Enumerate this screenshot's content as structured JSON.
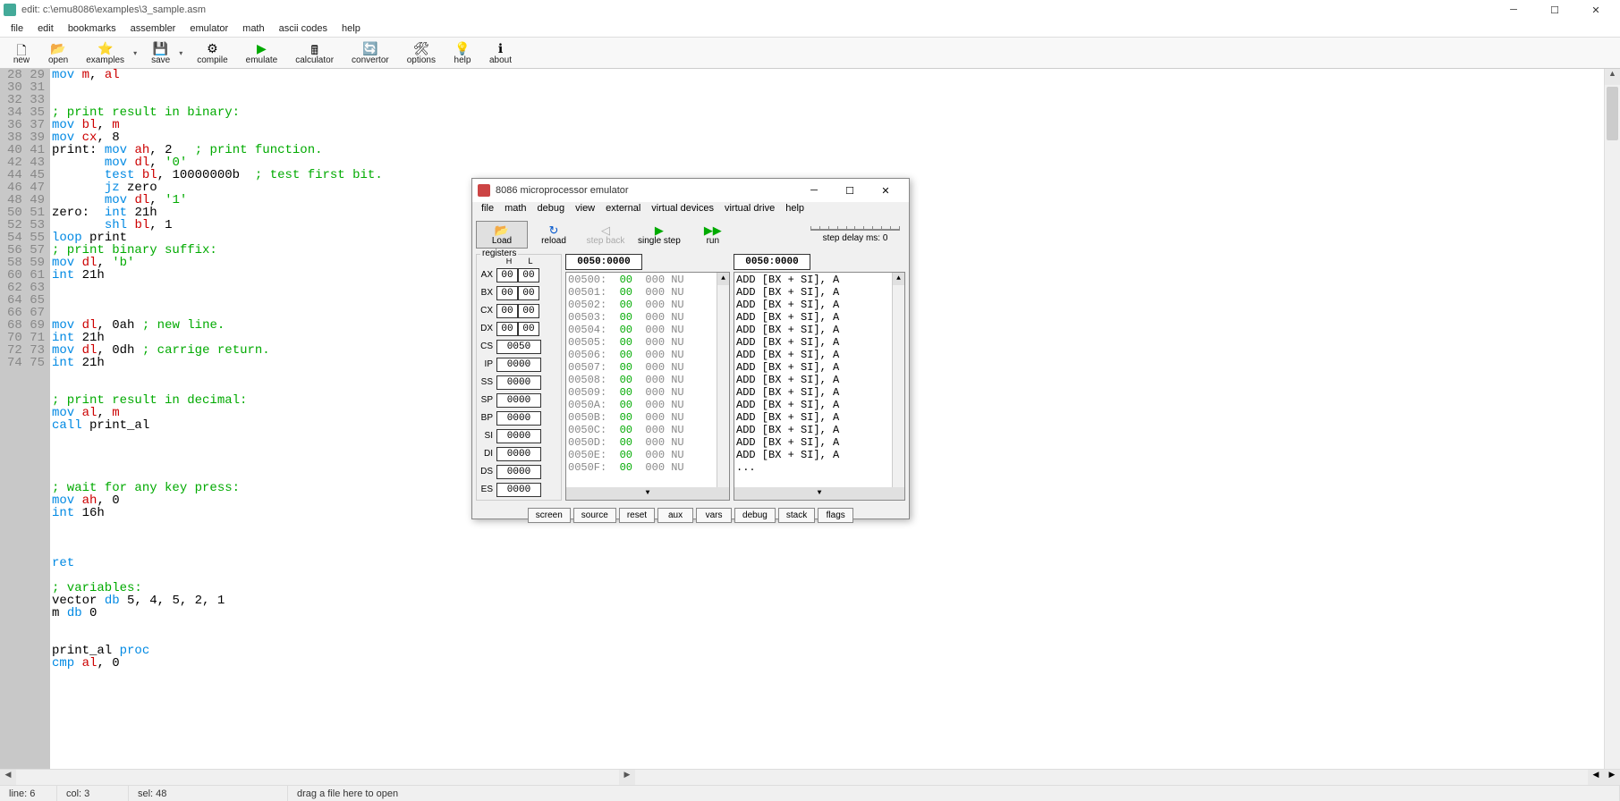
{
  "titlebar": {
    "title": "edit: c:\\emu8086\\examples\\3_sample.asm"
  },
  "menubar": [
    "file",
    "edit",
    "bookmarks",
    "assembler",
    "emulator",
    "math",
    "ascii codes",
    "help"
  ],
  "toolbar": [
    {
      "icon": "🗋",
      "label": "new"
    },
    {
      "icon": "📂",
      "label": "open"
    },
    {
      "icon": "⭐",
      "label": "examples",
      "dropdown": true
    },
    {
      "icon": "💾",
      "label": "save",
      "dropdown": true
    },
    {
      "icon": "⚙",
      "label": "compile"
    },
    {
      "icon": "▶",
      "label": "emulate",
      "color": "#0a0"
    },
    {
      "icon": "🖩",
      "label": "calculator"
    },
    {
      "icon": "🔄",
      "label": "convertor"
    },
    {
      "icon": "🛠",
      "label": "options"
    },
    {
      "icon": "💡",
      "label": "help"
    },
    {
      "icon": "ℹ",
      "label": "about"
    }
  ],
  "code_start_line": 28,
  "code_lines": [
    [
      [
        "kw",
        "mov"
      ],
      [
        " "
      ],
      [
        "reg",
        "m"
      ],
      [
        ", "
      ],
      [
        "reg",
        "al"
      ]
    ],
    [],
    [],
    [
      [
        "cmt",
        "; print result in binary:"
      ]
    ],
    [
      [
        "kw",
        "mov"
      ],
      [
        " "
      ],
      [
        "reg",
        "bl"
      ],
      [
        ", "
      ],
      [
        "reg",
        "m"
      ]
    ],
    [
      [
        "kw",
        "mov"
      ],
      [
        " "
      ],
      [
        "reg",
        "cx"
      ],
      [
        ", "
      ],
      [
        "num",
        "8"
      ]
    ],
    [
      [
        "",
        "print: "
      ],
      [
        "kw",
        "mov"
      ],
      [
        " "
      ],
      [
        "reg",
        "ah"
      ],
      [
        ", "
      ],
      [
        "num",
        "2"
      ],
      [
        "   "
      ],
      [
        "cmt",
        "; print function."
      ]
    ],
    [
      [
        "       "
      ],
      [
        "kw",
        "mov"
      ],
      [
        " "
      ],
      [
        "reg",
        "dl"
      ],
      [
        ", "
      ],
      [
        "str",
        "'0'"
      ]
    ],
    [
      [
        "       "
      ],
      [
        "kw",
        "test"
      ],
      [
        " "
      ],
      [
        "reg",
        "bl"
      ],
      [
        ", "
      ],
      [
        "num",
        "10000000b"
      ],
      [
        "  "
      ],
      [
        "cmt",
        "; test first bit."
      ]
    ],
    [
      [
        "       "
      ],
      [
        "kw",
        "jz"
      ],
      [
        "",
        " zero"
      ]
    ],
    [
      [
        "       "
      ],
      [
        "kw",
        "mov"
      ],
      [
        " "
      ],
      [
        "reg",
        "dl"
      ],
      [
        ", "
      ],
      [
        "str",
        "'1'"
      ]
    ],
    [
      [
        "",
        "zero:  "
      ],
      [
        "kw",
        "int"
      ],
      [
        " "
      ],
      [
        "num",
        "21h"
      ]
    ],
    [
      [
        "       "
      ],
      [
        "kw",
        "shl"
      ],
      [
        " "
      ],
      [
        "reg",
        "bl"
      ],
      [
        ", "
      ],
      [
        "num",
        "1"
      ]
    ],
    [
      [
        "kw",
        "loop"
      ],
      [
        " print"
      ]
    ],
    [
      [
        "cmt",
        "; print binary suffix:"
      ]
    ],
    [
      [
        "kw",
        "mov"
      ],
      [
        " "
      ],
      [
        "reg",
        "dl"
      ],
      [
        ", "
      ],
      [
        "str",
        "'b'"
      ]
    ],
    [
      [
        "kw",
        "int"
      ],
      [
        " "
      ],
      [
        "num",
        "21h"
      ]
    ],
    [],
    [],
    [],
    [
      [
        "kw",
        "mov"
      ],
      [
        " "
      ],
      [
        "reg",
        "dl"
      ],
      [
        ", "
      ],
      [
        "num",
        "0ah"
      ],
      [
        " "
      ],
      [
        "cmt",
        "; new line."
      ]
    ],
    [
      [
        "kw",
        "int"
      ],
      [
        " "
      ],
      [
        "num",
        "21h"
      ]
    ],
    [
      [
        "kw",
        "mov"
      ],
      [
        " "
      ],
      [
        "reg",
        "dl"
      ],
      [
        ", "
      ],
      [
        "num",
        "0dh"
      ],
      [
        " "
      ],
      [
        "cmt",
        "; carrige return."
      ]
    ],
    [
      [
        "kw",
        "int"
      ],
      [
        " "
      ],
      [
        "num",
        "21h"
      ]
    ],
    [],
    [],
    [
      [
        "cmt",
        "; print result in decimal:"
      ]
    ],
    [
      [
        "kw",
        "mov"
      ],
      [
        " "
      ],
      [
        "reg",
        "al"
      ],
      [
        ", "
      ],
      [
        "reg",
        "m"
      ]
    ],
    [
      [
        "kw",
        "call"
      ],
      [
        " print_al"
      ]
    ],
    [],
    [],
    [],
    [],
    [
      [
        "cmt",
        "; wait for any key press:"
      ]
    ],
    [
      [
        "kw",
        "mov"
      ],
      [
        " "
      ],
      [
        "reg",
        "ah"
      ],
      [
        ", "
      ],
      [
        "num",
        "0"
      ]
    ],
    [
      [
        "kw",
        "int"
      ],
      [
        " "
      ],
      [
        "num",
        "16h"
      ]
    ],
    [],
    [],
    [],
    [
      [
        "kw",
        "ret"
      ]
    ],
    [],
    [
      [
        "cmt",
        "; variables:"
      ]
    ],
    [
      [
        "",
        "vector "
      ],
      [
        "kw",
        "db"
      ],
      [
        " "
      ],
      [
        "num",
        "5, 4, 5, 2, 1"
      ]
    ],
    [
      [
        "",
        "m "
      ],
      [
        "kw",
        "db"
      ],
      [
        " "
      ],
      [
        "num",
        "0"
      ]
    ],
    [],
    [],
    [
      [
        "",
        "print_al "
      ],
      [
        "kw",
        "proc"
      ]
    ],
    [
      [
        "kw",
        "cmp"
      ],
      [
        " "
      ],
      [
        "reg",
        "al"
      ],
      [
        ", "
      ],
      [
        "num",
        "0"
      ]
    ]
  ],
  "statusbar": {
    "line": "line: 6",
    "col": "col: 3",
    "sel": "sel: 48",
    "drag": "drag a file here to open"
  },
  "emulator": {
    "title": "8086 microprocessor emulator",
    "menu": [
      "file",
      "math",
      "debug",
      "view",
      "external",
      "virtual devices",
      "virtual drive",
      "help"
    ],
    "toolbar": [
      {
        "icon": "📂",
        "label": "Load",
        "pressed": true
      },
      {
        "icon": "↻",
        "label": "reload",
        "color": "#05c"
      },
      {
        "icon": "◁",
        "label": "step back",
        "disabled": true
      },
      {
        "icon": "▶",
        "label": "single step",
        "color": "#0a0"
      },
      {
        "icon": "▶▶",
        "label": "run",
        "color": "#0a0"
      }
    ],
    "delay_label": "step delay ms: 0",
    "registers_label": "registers",
    "reg_header": {
      "H": "H",
      "L": "L"
    },
    "regs_pair": [
      {
        "name": "AX",
        "h": "00",
        "l": "00"
      },
      {
        "name": "BX",
        "h": "00",
        "l": "00"
      },
      {
        "name": "CX",
        "h": "00",
        "l": "00"
      },
      {
        "name": "DX",
        "h": "00",
        "l": "00"
      }
    ],
    "regs_wide": [
      {
        "name": "CS",
        "val": "0050"
      },
      {
        "name": "IP",
        "val": "0000"
      },
      {
        "name": "SS",
        "val": "0000"
      },
      {
        "name": "SP",
        "val": "0000"
      },
      {
        "name": "BP",
        "val": "0000"
      },
      {
        "name": "SI",
        "val": "0000"
      },
      {
        "name": "DI",
        "val": "0000"
      },
      {
        "name": "DS",
        "val": "0000"
      },
      {
        "name": "ES",
        "val": "0000"
      }
    ],
    "mem_addr1": "0050:0000",
    "mem_addr2": "0050:0000",
    "mem_rows": [
      {
        "addr": "00500:",
        "hex": "00",
        "dec": "000",
        "ch": "NU"
      },
      {
        "addr": "00501:",
        "hex": "00",
        "dec": "000",
        "ch": "NU"
      },
      {
        "addr": "00502:",
        "hex": "00",
        "dec": "000",
        "ch": "NU"
      },
      {
        "addr": "00503:",
        "hex": "00",
        "dec": "000",
        "ch": "NU"
      },
      {
        "addr": "00504:",
        "hex": "00",
        "dec": "000",
        "ch": "NU"
      },
      {
        "addr": "00505:",
        "hex": "00",
        "dec": "000",
        "ch": "NU"
      },
      {
        "addr": "00506:",
        "hex": "00",
        "dec": "000",
        "ch": "NU"
      },
      {
        "addr": "00507:",
        "hex": "00",
        "dec": "000",
        "ch": "NU"
      },
      {
        "addr": "00508:",
        "hex": "00",
        "dec": "000",
        "ch": "NU"
      },
      {
        "addr": "00509:",
        "hex": "00",
        "dec": "000",
        "ch": "NU"
      },
      {
        "addr": "0050A:",
        "hex": "00",
        "dec": "000",
        "ch": "NU"
      },
      {
        "addr": "0050B:",
        "hex": "00",
        "dec": "000",
        "ch": "NU"
      },
      {
        "addr": "0050C:",
        "hex": "00",
        "dec": "000",
        "ch": "NU"
      },
      {
        "addr": "0050D:",
        "hex": "00",
        "dec": "000",
        "ch": "NU"
      },
      {
        "addr": "0050E:",
        "hex": "00",
        "dec": "000",
        "ch": "NU"
      },
      {
        "addr": "0050F:",
        "hex": "00",
        "dec": "000",
        "ch": "NU"
      }
    ],
    "disasm_rows": [
      "ADD [BX + SI], A",
      "ADD [BX + SI], A",
      "ADD [BX + SI], A",
      "ADD [BX + SI], A",
      "ADD [BX + SI], A",
      "ADD [BX + SI], A",
      "ADD [BX + SI], A",
      "ADD [BX + SI], A",
      "ADD [BX + SI], A",
      "ADD [BX + SI], A",
      "ADD [BX + SI], A",
      "ADD [BX + SI], A",
      "ADD [BX + SI], A",
      "ADD [BX + SI], A",
      "ADD [BX + SI], A",
      "..."
    ],
    "bottom_buttons": [
      "screen",
      "source",
      "reset",
      "aux",
      "vars",
      "debug",
      "stack",
      "flags"
    ]
  }
}
